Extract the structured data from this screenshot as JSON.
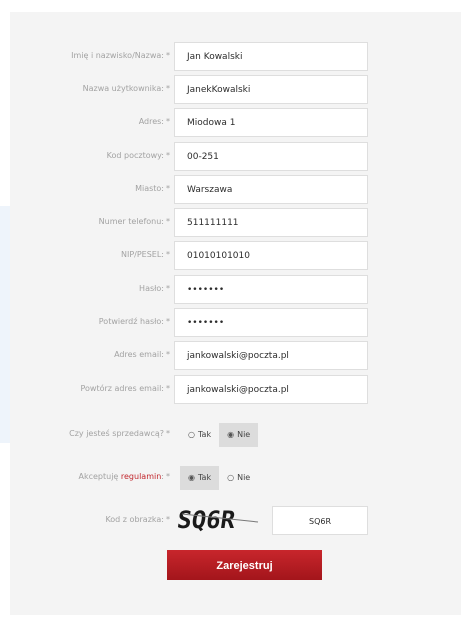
{
  "form": {
    "fields": [
      {
        "label": "Imię i nazwisko/Nazwa:",
        "req": "*",
        "value": "Jan Kowalski"
      },
      {
        "label": "Nazwa użytkownika:",
        "req": "*",
        "value": "JanekKowalski"
      },
      {
        "label": "Adres:",
        "req": "*",
        "value": "Miodowa 1"
      },
      {
        "label": "Kod pocztowy:",
        "req": "*",
        "value": "00-251"
      },
      {
        "label": "Miasto:",
        "req": "*",
        "value": "Warszawa"
      },
      {
        "label": "Numer telefonu:",
        "req": "*",
        "value": "511111111"
      },
      {
        "label": "NIP/PESEL:",
        "req": "*",
        "value": "01010101010"
      },
      {
        "label": "Hasło:",
        "req": "*",
        "value": "•••••••"
      },
      {
        "label": "Potwierdź hasło:",
        "req": "*",
        "value": "•••••••"
      },
      {
        "label": "Adres email:",
        "req": "*",
        "value": "jankowalski@poczta.pl"
      },
      {
        "label": "Powtórz adres email:",
        "req": "*",
        "value": "jankowalski@poczta.pl"
      }
    ],
    "seller": {
      "label": "Czy jesteś sprzedawcą?",
      "req": "*",
      "options": [
        {
          "text": "Tak",
          "selected": false
        },
        {
          "text": "Nie",
          "selected": true
        }
      ]
    },
    "terms": {
      "label_prefix": "Akceptuję",
      "link_text": "regulamin",
      "label_suffix": ":",
      "req": "*",
      "options": [
        {
          "text": "Tak",
          "selected": true
        },
        {
          "text": "Nie",
          "selected": false
        }
      ]
    },
    "captcha": {
      "label": "Kod z obrazka:",
      "req": "*",
      "image_text": "SQ6R",
      "value": "SQ6R"
    },
    "submit_label": "Zarejestruj"
  },
  "colors": {
    "accent": "#c2282e",
    "panel_bg": "#f4f4f4",
    "label": "#a2a2a2"
  }
}
